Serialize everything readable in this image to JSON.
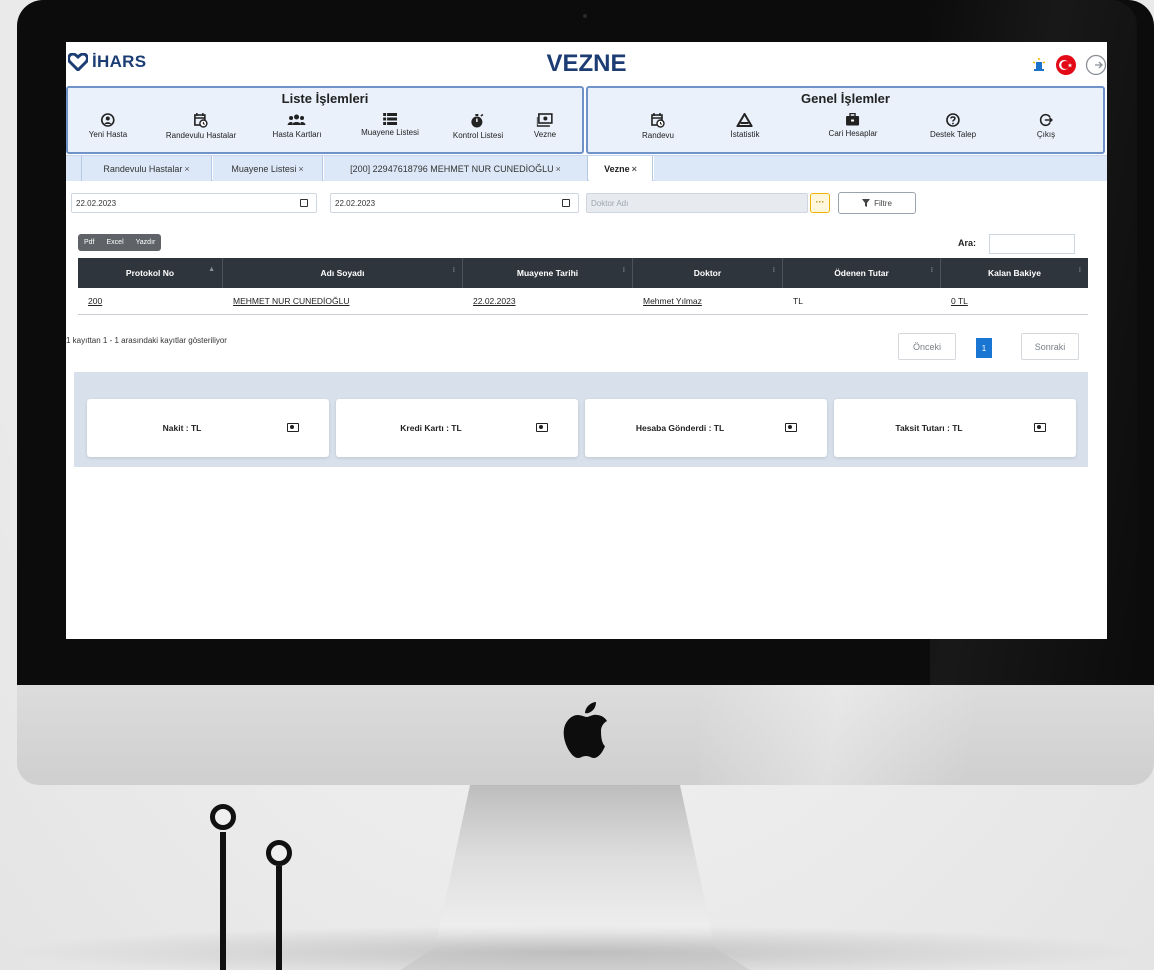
{
  "app": {
    "logo_text": "İHARS",
    "title": "VEZNE"
  },
  "colors": {
    "brand": "#1c3d73",
    "panel_border": "#6f93c9",
    "panel_bg": "#eaf1fb",
    "table_header": "#2f353d",
    "active_page": "#1976d2",
    "dots_button": "#f0b400"
  },
  "top_icons": [
    "bell-icon",
    "turkish-flag-icon",
    "logout-icon"
  ],
  "liste_islemleri": {
    "title": "Liste İşlemleri",
    "items": [
      {
        "label": "Yeni Hasta",
        "icon": "user-circle-icon"
      },
      {
        "label": "Randevulu Hastalar",
        "icon": "calendar-clock-icon"
      },
      {
        "label": "Hasta Kartları",
        "icon": "users-icon"
      },
      {
        "label": "Muayene Listesi",
        "icon": "list-icon"
      },
      {
        "label": "Kontrol Listesi",
        "icon": "stopwatch-icon"
      },
      {
        "label": "Vezne",
        "icon": "cash-register-icon"
      }
    ]
  },
  "genel_islemler": {
    "title": "Genel İşlemler",
    "items": [
      {
        "label": "Randevu",
        "icon": "calendar-clock-icon"
      },
      {
        "label": "İstatistik",
        "icon": "chart-triangle-icon"
      },
      {
        "label": "Cari Hesaplar",
        "icon": "briefcase-icon"
      },
      {
        "label": "Destek Talep",
        "icon": "help-circle-icon"
      },
      {
        "label": "Çıkış",
        "icon": "logout-icon"
      }
    ]
  },
  "tabs": [
    {
      "label": "Randevulu Hastalar",
      "close": "×"
    },
    {
      "label": "Muayene Listesi",
      "close": "×"
    },
    {
      "label": "[200] 22947618796 MEHMET NUR CUNEDİOĞLU",
      "close": "×"
    },
    {
      "label": "Vezne",
      "close": "×"
    }
  ],
  "filters": {
    "start_date": "22.02.2023",
    "end_date": "22.02.2023",
    "doctor_placeholder": "Doktor Adı",
    "dots_label": "···",
    "filter_label": "Filtre"
  },
  "export": [
    "Pdf",
    "Excel",
    "Yazdır"
  ],
  "search": {
    "label": "Ara:"
  },
  "table": {
    "headers": [
      "Protokol No",
      "Adı Soyadı",
      "Muayene Tarihi",
      "Doktor",
      "Ödenen Tutar",
      "Kalan Bakiye"
    ],
    "rows": [
      [
        "200",
        "MEHMET NUR CUNEDİOĞLU",
        "22.02.2023",
        "Mehmet Yılmaz",
        "TL",
        "0 TL"
      ]
    ]
  },
  "info_text": "1 kayıttan 1 - 1 arasındaki kayıtlar gösteriliyor",
  "pagination": {
    "prev": "Önceki",
    "current": "1",
    "next": "Sonraki"
  },
  "payments": [
    {
      "label": "Nakit : TL",
      "icon": "money-icon"
    },
    {
      "label": "Kredi Kartı : TL",
      "icon": "money-icon"
    },
    {
      "label": "Hesaba Gönderdi : TL",
      "icon": "money-icon"
    },
    {
      "label": "Taksit Tutarı : TL",
      "icon": "money-icon"
    }
  ]
}
